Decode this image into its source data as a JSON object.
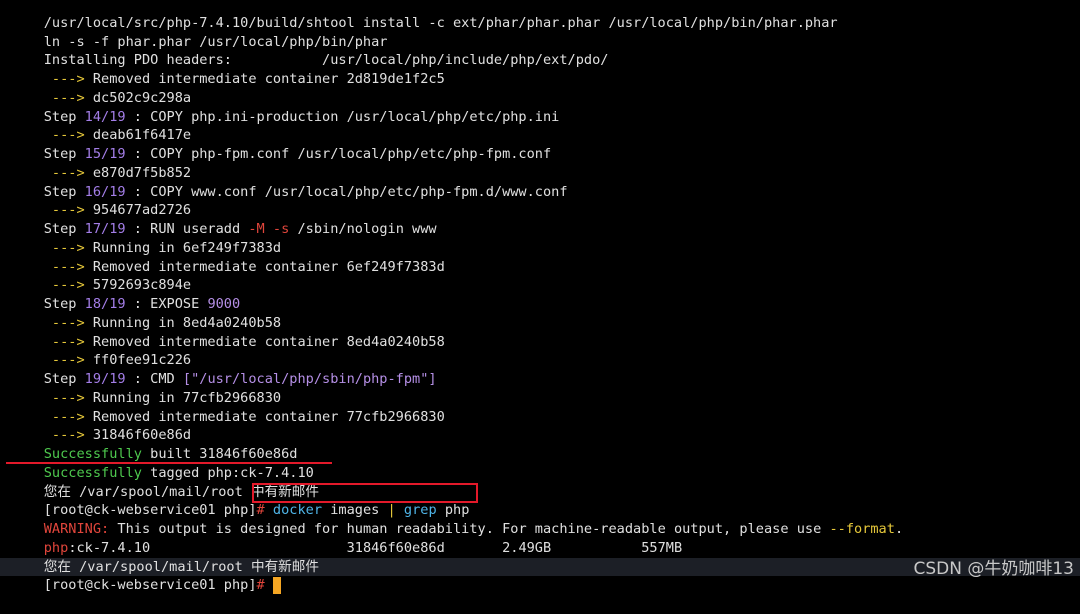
{
  "lines": [
    [
      "/usr/local/src/php-7.4.10/build/shtool install -c ext/phar/phar.phar /usr/local/php/bin/phar.phar"
    ],
    [
      "ln -s -f phar.phar /usr/local/php/bin/phar"
    ],
    [
      "Installing PDO headers:           /usr/local/php/include/php/ext/pdo/"
    ],
    [
      " ---> ",
      "Removed intermediate container 2d819de1f2c5"
    ],
    [
      " ---> ",
      "dc502c9c298a"
    ],
    [
      "Step ",
      "14/19",
      " : COPY php.ini-production /usr/local/php/etc/php.ini"
    ],
    [
      " ---> ",
      "deab61f6417e"
    ],
    [
      "Step ",
      "15/19",
      " : COPY php-fpm.conf /usr/local/php/etc/php-fpm.conf"
    ],
    [
      " ---> ",
      "e870d7f5b852"
    ],
    [
      "Step ",
      "16/19",
      " : COPY www.conf /usr/local/php/etc/php-fpm.d/www.conf"
    ],
    [
      " ---> ",
      "954677ad2726"
    ],
    [
      "Step ",
      "17/19",
      " : RUN useradd ",
      "-M",
      " ",
      "-s",
      " /sbin/nologin www"
    ],
    [
      " ---> ",
      "Running in 6ef249f7383d"
    ],
    [
      " ---> ",
      "Removed intermediate container 6ef249f7383d"
    ],
    [
      " ---> ",
      "5792693c894e"
    ],
    [
      "Step ",
      "18/19",
      " : EXPOSE ",
      "9000"
    ],
    [
      " ---> ",
      "Running in 8ed4a0240b58"
    ],
    [
      " ---> ",
      "Removed intermediate container 8ed4a0240b58"
    ],
    [
      " ---> ",
      "ff0fee91c226"
    ],
    [
      "Step ",
      "19/19",
      " : CMD ",
      "[\"/usr/local/php/sbin/php-fpm\"]"
    ],
    [
      " ---> ",
      "Running in 77cfb2966830"
    ],
    [
      " ---> ",
      "Removed intermediate container 77cfb2966830"
    ],
    [
      " ---> ",
      "31846f60e86d"
    ],
    [
      "Successfully",
      " built 31846f60e86d"
    ],
    [
      "Successfully",
      " tagged php:ck-7.4.10"
    ],
    [
      "您在 /var/spool/mail/root 中有新邮件"
    ],
    [
      "[root@ck-webservice01 php]",
      "# ",
      "docker",
      " images ",
      "|",
      " ",
      "grep",
      " php"
    ],
    [
      "WARNING:",
      " This output is designed for human readability. For machine-readable output, please use ",
      "--format",
      "."
    ],
    [
      "php",
      ":ck-7.4.10                        31846f60e86d       2.49GB           557MB"
    ],
    [
      "您在 /var/spool/mail/root 中有新邮件"
    ],
    [
      "[root@ck-webservice01 php]",
      "# "
    ]
  ],
  "watermark": "CSDN @牛奶咖啡13"
}
